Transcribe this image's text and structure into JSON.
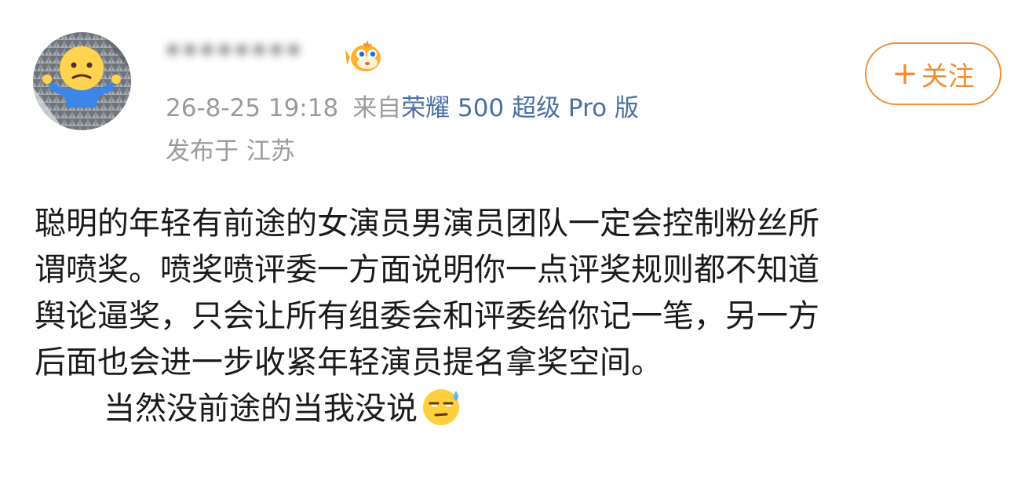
{
  "author": {
    "name": "********",
    "avatar_icon": "confused-shrug-emoji-avatar-icon",
    "badge_icon": "orange-pufferfish-badge-icon"
  },
  "post_meta": {
    "timestamp": "26-8-25 19:18",
    "source_label": "来自",
    "device": "荣耀 500 超级 Pro 版",
    "location": "发布于 江苏"
  },
  "follow_button": {
    "plus": "+",
    "label": "关注"
  },
  "post_body": {
    "lines": [
      "聪明的年轻有前途的女演员男演员团队一定会控制粉丝所",
      "谓喷奖。喷奖喷评委一方面说明你一点评奖规则都不知道",
      "舆论逼奖，只会让所有组委会和评委给你记一笔，另一方",
      "后面也会进一步收紧年轻演员提名拿奖空间。"
    ],
    "last_line": "当然没前途的当我没说",
    "trailing_emoji_icon": "sweat-unamused-emoji-icon"
  },
  "colors": {
    "accent": "#f08e36",
    "link": "#4a6fa5",
    "meta_text": "#9b9b9b",
    "body_text": "#1a1a1a"
  }
}
